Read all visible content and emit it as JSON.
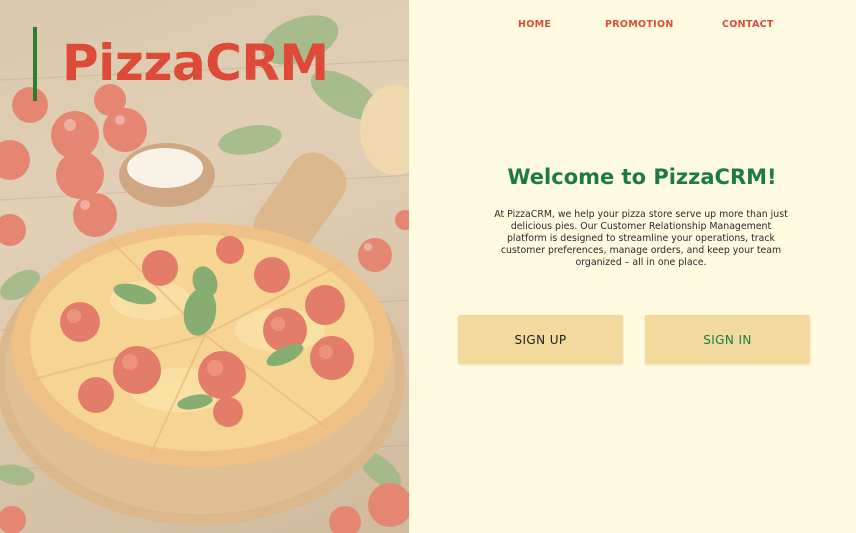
{
  "brand": {
    "name": "PizzaCRM",
    "accent_color": "#de4a38",
    "bar_color": "#2e7d32"
  },
  "nav": {
    "items": [
      {
        "label": "HOME"
      },
      {
        "label": "PROMOTION"
      },
      {
        "label": "CONTACT"
      }
    ]
  },
  "hero": {
    "image": "pizza-on-wooden-board"
  },
  "main": {
    "heading": "Welcome to PizzaCRM!",
    "description": "At PizzaCRM, we help your pizza store serve up more than just delicious pies. Our Customer Relationship Management platform is designed to streamline your operations, track customer preferences, manage orders, and keep your team organized – all in one place.",
    "buttons": {
      "signup_label": "SIGN UP",
      "signin_label": "SIGN IN"
    }
  },
  "colors": {
    "panel_bg": "#fffbe0",
    "heading": "#1e7a43",
    "nav_link": "#e04a3a",
    "button_bg": "#f2da9e"
  }
}
